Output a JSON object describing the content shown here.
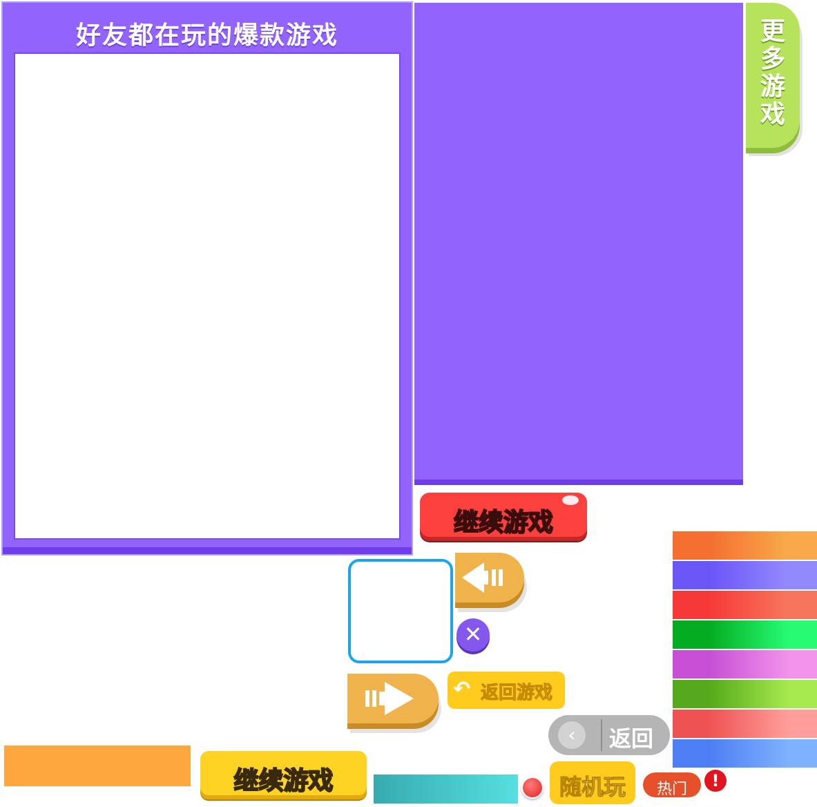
{
  "friends_panel": {
    "title": "好友都在玩的爆款游戏"
  },
  "more_games_tab": {
    "chars": [
      "更",
      "多",
      "游",
      "戏"
    ]
  },
  "buttons": {
    "continue_game_red": "继续游戏",
    "continue_game_yellow": "继续游戏",
    "return_to_game": "返回游戏",
    "back": "返回",
    "random_play": "随机玩",
    "hot": "热门",
    "alert": "!"
  },
  "icons": {
    "left_arrow": "arrow-left-icon",
    "right_arrow": "arrow-right-icon",
    "close": "close-icon",
    "return": "return-icon",
    "chevron_left": "chevron-left-icon",
    "alert": "alert-icon"
  },
  "colors": {
    "panel_purple": "#9263fd",
    "more_games_green": "#b7e35c",
    "continue_red": "#fb403d",
    "continue_yellow": "#ffd324",
    "accent_orange": "#f0b24a",
    "blue_outline": "#1aa4f2"
  },
  "gradient_strips": [
    {
      "from": "#f46f30",
      "to": "#f9a94a"
    },
    {
      "from": "#6a55f7",
      "to": "#9389ff"
    },
    {
      "from": "#f73838",
      "to": "#f7765b"
    },
    {
      "from": "#04ac21",
      "to": "#27fb72"
    },
    {
      "from": "#c64fd5",
      "to": "#f292ea"
    },
    {
      "from": "#55a91b",
      "to": "#a6e94e"
    },
    {
      "from": "#ef5252",
      "to": "#ff9e9a"
    },
    {
      "from": "#4d7ef4",
      "to": "#7eb1ff"
    }
  ]
}
